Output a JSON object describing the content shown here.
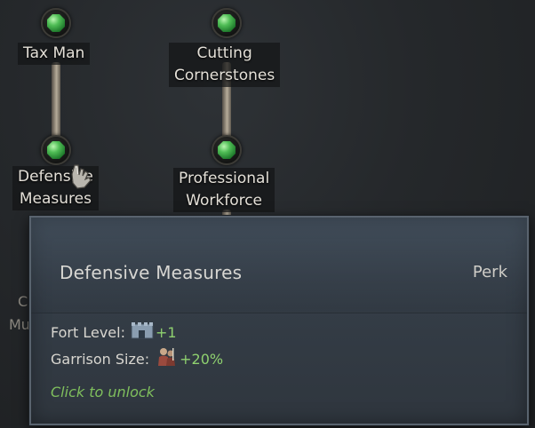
{
  "perk_tree": {
    "nodes": [
      {
        "label_lines": [
          "Tax Man"
        ],
        "state": "unlocked",
        "gem_icon": "green-gem-icon"
      },
      {
        "label_lines": [
          "Cutting",
          "Cornerstones"
        ],
        "state": "unlocked",
        "gem_icon": "green-gem-icon"
      },
      {
        "label_lines": [
          "Defensive",
          "Measures"
        ],
        "state": "hovered",
        "gem_icon": "green-gem-icon"
      },
      {
        "label_lines": [
          "Professional",
          "Workforce"
        ],
        "state": "unlocked",
        "gem_icon": "green-gem-icon"
      }
    ],
    "partial_labels": [
      "C",
      "Mu"
    ]
  },
  "cursor": {
    "icon": "gauntlet-hand-cursor-icon"
  },
  "tooltip": {
    "title": "Defensive Measures",
    "type": "Perk",
    "effects": [
      {
        "label": "Fort Level:",
        "icon": "fort-icon",
        "value": "+1"
      },
      {
        "label": "Garrison Size:",
        "icon": "garrison-soldiers-icon",
        "value": "+20%"
      }
    ],
    "action": "Click to unlock"
  },
  "colors": {
    "bonus_green": "#8fd16f",
    "action_green": "#7fbf5d",
    "tooltip_bg": "#353e48",
    "gem_green": "#4fbd55"
  }
}
